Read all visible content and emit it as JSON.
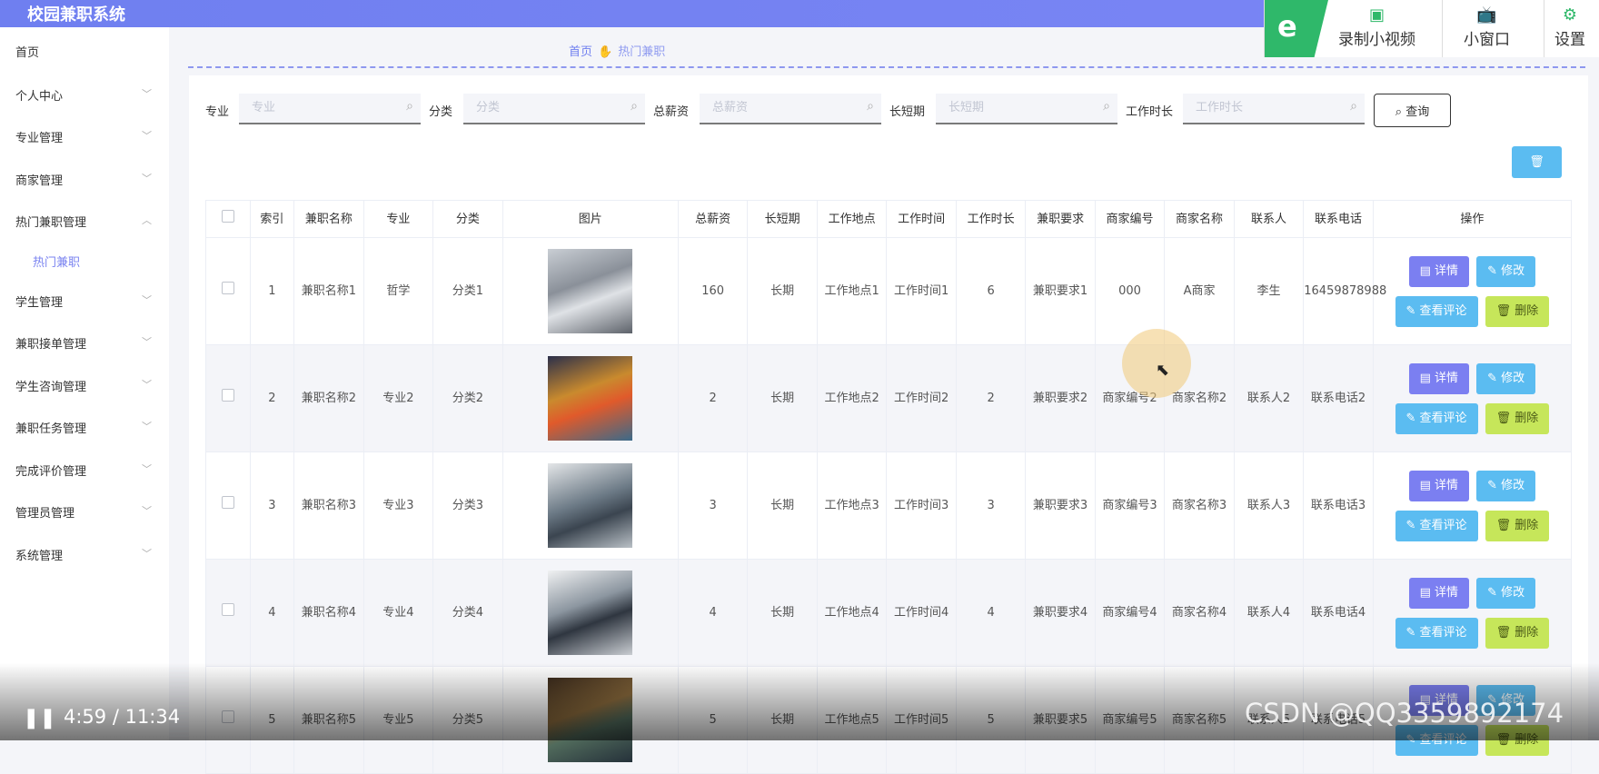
{
  "app": {
    "title": "校园兼职系统"
  },
  "sidebar": {
    "items": [
      {
        "label": "首页",
        "expandable": false
      },
      {
        "label": "个人中心",
        "expandable": true
      },
      {
        "label": "专业管理",
        "expandable": true
      },
      {
        "label": "商家管理",
        "expandable": true
      },
      {
        "label": "热门兼职管理",
        "expandable": true,
        "expanded": true
      },
      {
        "label": "学生管理",
        "expandable": true
      },
      {
        "label": "兼职接单管理",
        "expandable": true
      },
      {
        "label": "学生咨询管理",
        "expandable": true
      },
      {
        "label": "兼职任务管理",
        "expandable": true
      },
      {
        "label": "完成评价管理",
        "expandable": true
      },
      {
        "label": "管理员管理",
        "expandable": true
      },
      {
        "label": "系统管理",
        "expandable": true
      }
    ],
    "active_sub": "热门兼职"
  },
  "breadcrumb": {
    "home": "首页",
    "current": "热门兼职"
  },
  "filters": [
    {
      "label": "专业",
      "placeholder": "专业"
    },
    {
      "label": "分类",
      "placeholder": "分类"
    },
    {
      "label": "总薪资",
      "placeholder": "总薪资"
    },
    {
      "label": "长短期",
      "placeholder": "长短期"
    },
    {
      "label": "工作时长",
      "placeholder": "工作时长"
    }
  ],
  "query_button": "查询",
  "table": {
    "headers": [
      "索引",
      "兼职名称",
      "专业",
      "分类",
      "图片",
      "总薪资",
      "长短期",
      "工作地点",
      "工作时间",
      "工作时长",
      "兼职要求",
      "商家编号",
      "商家名称",
      "联系人",
      "联系电话",
      "操作"
    ],
    "rows": [
      {
        "index": "1",
        "name": "兼职名称1",
        "major": "哲学",
        "category": "分类1",
        "salary": "160",
        "term": "长期",
        "location": "工作地点1",
        "time": "工作时间1",
        "hours": "6",
        "req": "兼职要求1",
        "merchant_no": "000",
        "merchant": "A商家",
        "contact": "李生",
        "phone": "16459878988"
      },
      {
        "index": "2",
        "name": "兼职名称2",
        "major": "专业2",
        "category": "分类2",
        "salary": "2",
        "term": "长期",
        "location": "工作地点2",
        "time": "工作时间2",
        "hours": "2",
        "req": "兼职要求2",
        "merchant_no": "商家编号2",
        "merchant": "商家名称2",
        "contact": "联系人2",
        "phone": "联系电话2"
      },
      {
        "index": "3",
        "name": "兼职名称3",
        "major": "专业3",
        "category": "分类3",
        "salary": "3",
        "term": "长期",
        "location": "工作地点3",
        "time": "工作时间3",
        "hours": "3",
        "req": "兼职要求3",
        "merchant_no": "商家编号3",
        "merchant": "商家名称3",
        "contact": "联系人3",
        "phone": "联系电话3"
      },
      {
        "index": "4",
        "name": "兼职名称4",
        "major": "专业4",
        "category": "分类4",
        "salary": "4",
        "term": "长期",
        "location": "工作地点4",
        "time": "工作时间4",
        "hours": "4",
        "req": "兼职要求4",
        "merchant_no": "商家编号4",
        "merchant": "商家名称4",
        "contact": "联系人4",
        "phone": "联系电话4"
      },
      {
        "index": "5",
        "name": "兼职名称5",
        "major": "专业5",
        "category": "分类5",
        "salary": "5",
        "term": "长期",
        "location": "工作地点5",
        "time": "工作时间5",
        "hours": "5",
        "req": "兼职要求5",
        "merchant_no": "商家编号5",
        "merchant": "商家名称5",
        "contact": "联系人5",
        "phone": "联系电话5"
      }
    ],
    "row_actions": {
      "detail": "详情",
      "edit": "修改",
      "review": "查看评论",
      "delete": "删除"
    }
  },
  "recorder": {
    "record": "录制小视频",
    "mini": "小窗口",
    "settings": "设置"
  },
  "video": {
    "time": "4:59 / 11:34",
    "watermark": "CSDN @QQ3359892174"
  },
  "colors": {
    "accent": "#7b86f5",
    "info": "#5bbcf1",
    "danger": "#c6e65a",
    "primary_btn": "#7b7ff1"
  }
}
